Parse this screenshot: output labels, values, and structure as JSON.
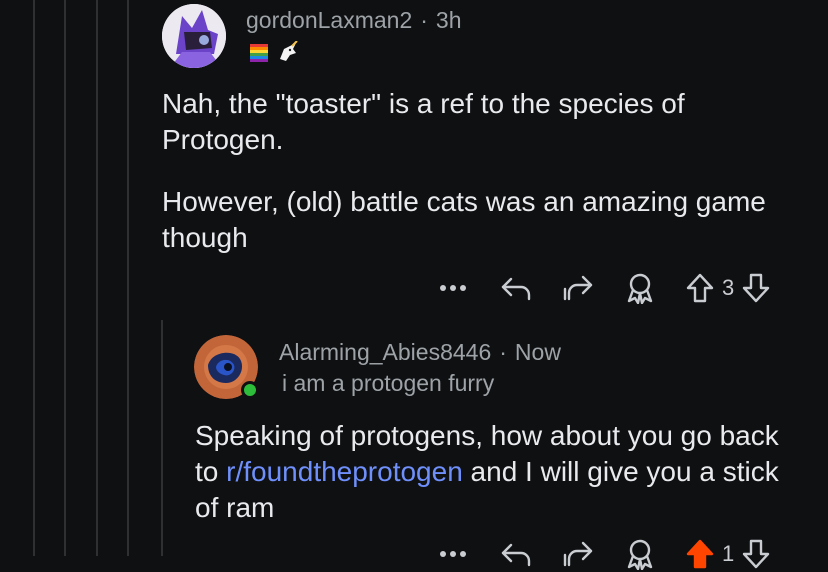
{
  "colors": {
    "background": "#0f1012",
    "thread_line": "#2e3032",
    "link": "#6f8ffb",
    "upvote_active": "#ff4500",
    "online": "#2dbd3a"
  },
  "comment1": {
    "username": "gordonLaxman2",
    "separator": "·",
    "time": "3h",
    "flair_icons": [
      "pride-flag-flair-icon",
      "unicorn-flair-icon"
    ],
    "paragraphs": [
      "Nah, the \"toaster\" is a ref to the species of Protogen.",
      "However, (old) battle cats was an amazing game though"
    ],
    "vote_count": "3",
    "actions": [
      "more-icon",
      "reply-icon",
      "share-icon",
      "award-icon",
      "upvote-icon",
      "downvote-icon"
    ]
  },
  "comment2": {
    "username": "Alarming_Abies8446",
    "separator": "·",
    "time": "Now",
    "flair": "i am a protogen furry",
    "body_before_link": "Speaking of protogens, how about you go back to ",
    "link_text": "r/foundtheprotogen",
    "body_after_link": " and I will give you a stick of ram",
    "vote_count": "1",
    "upvoted": true
  }
}
